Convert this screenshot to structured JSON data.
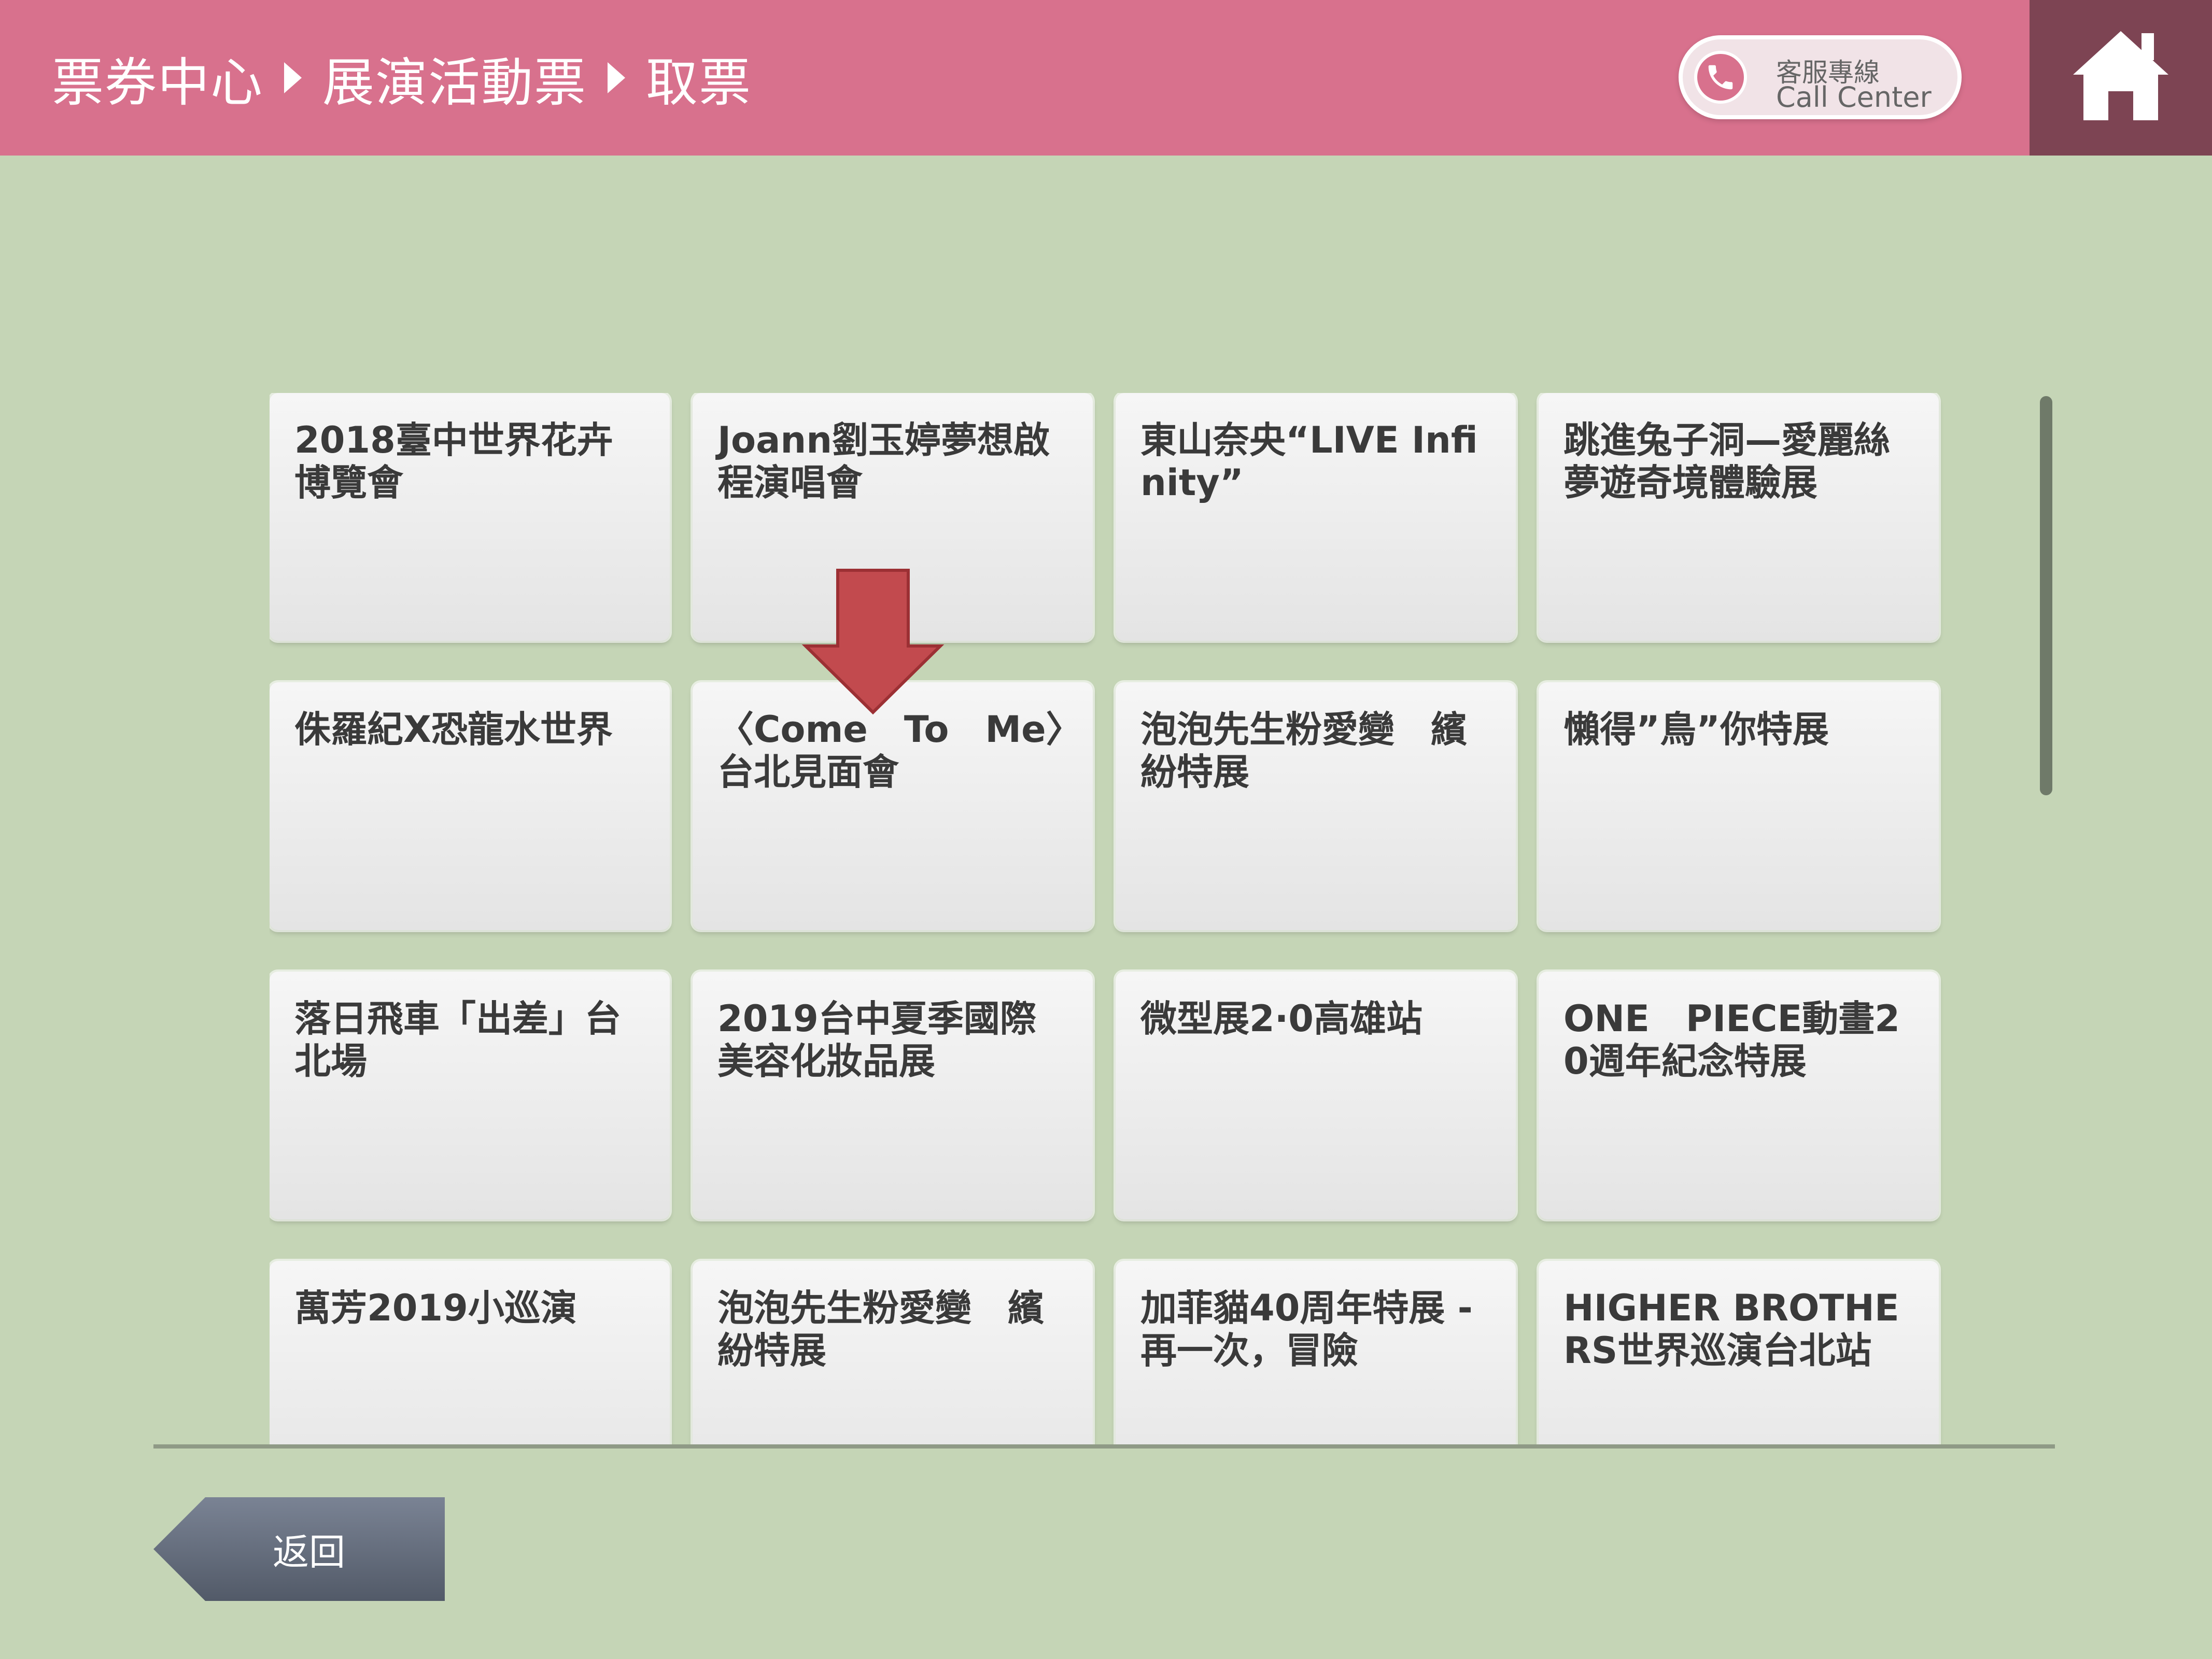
{
  "header": {
    "breadcrumb": [
      "票券中心",
      "展演活動票",
      "取票"
    ],
    "call_center": {
      "label_zh": "客服專線",
      "label_en": "Call Center",
      "icon": "phone-icon"
    },
    "home_icon": "home-icon",
    "bg_color": "#d8718d",
    "home_bg_color": "#7d4453"
  },
  "events": [
    {
      "title": "2018臺中世界花卉博覽會"
    },
    {
      "title": "Joann劉玉婷夢想啟程演唱會"
    },
    {
      "title": "東山奈央“LIVE Infinity”"
    },
    {
      "title": "跳進兔子洞—愛麗絲夢遊奇境體驗展"
    },
    {
      "title": "侏羅紀X恐龍水世界"
    },
    {
      "title": "〈Come　To　Me〉台北見面會"
    },
    {
      "title": "泡泡先生粉愛變　繽紛特展"
    },
    {
      "title": "懶得”鳥”你特展"
    },
    {
      "title": "落日飛車「出差」台北場"
    },
    {
      "title": "2019台中夏季國際美容化妝品展"
    },
    {
      "title": "微型展2·0高雄站"
    },
    {
      "title": "ONE　PIECE動畫20週年紀念特展"
    },
    {
      "title": "萬芳2019小巡演"
    },
    {
      "title": "泡泡先生粉愛變　繽紛特展"
    },
    {
      "title": "加菲貓40周年特展 - 再一次，冒險"
    },
    {
      "title": "HIGHER BROTHERS世界巡演台北站"
    }
  ],
  "footer": {
    "back_label": "返回"
  },
  "colors": {
    "background": "#c5d5b6",
    "arrow": "#c24a4e",
    "back_button": "#5e6776"
  }
}
